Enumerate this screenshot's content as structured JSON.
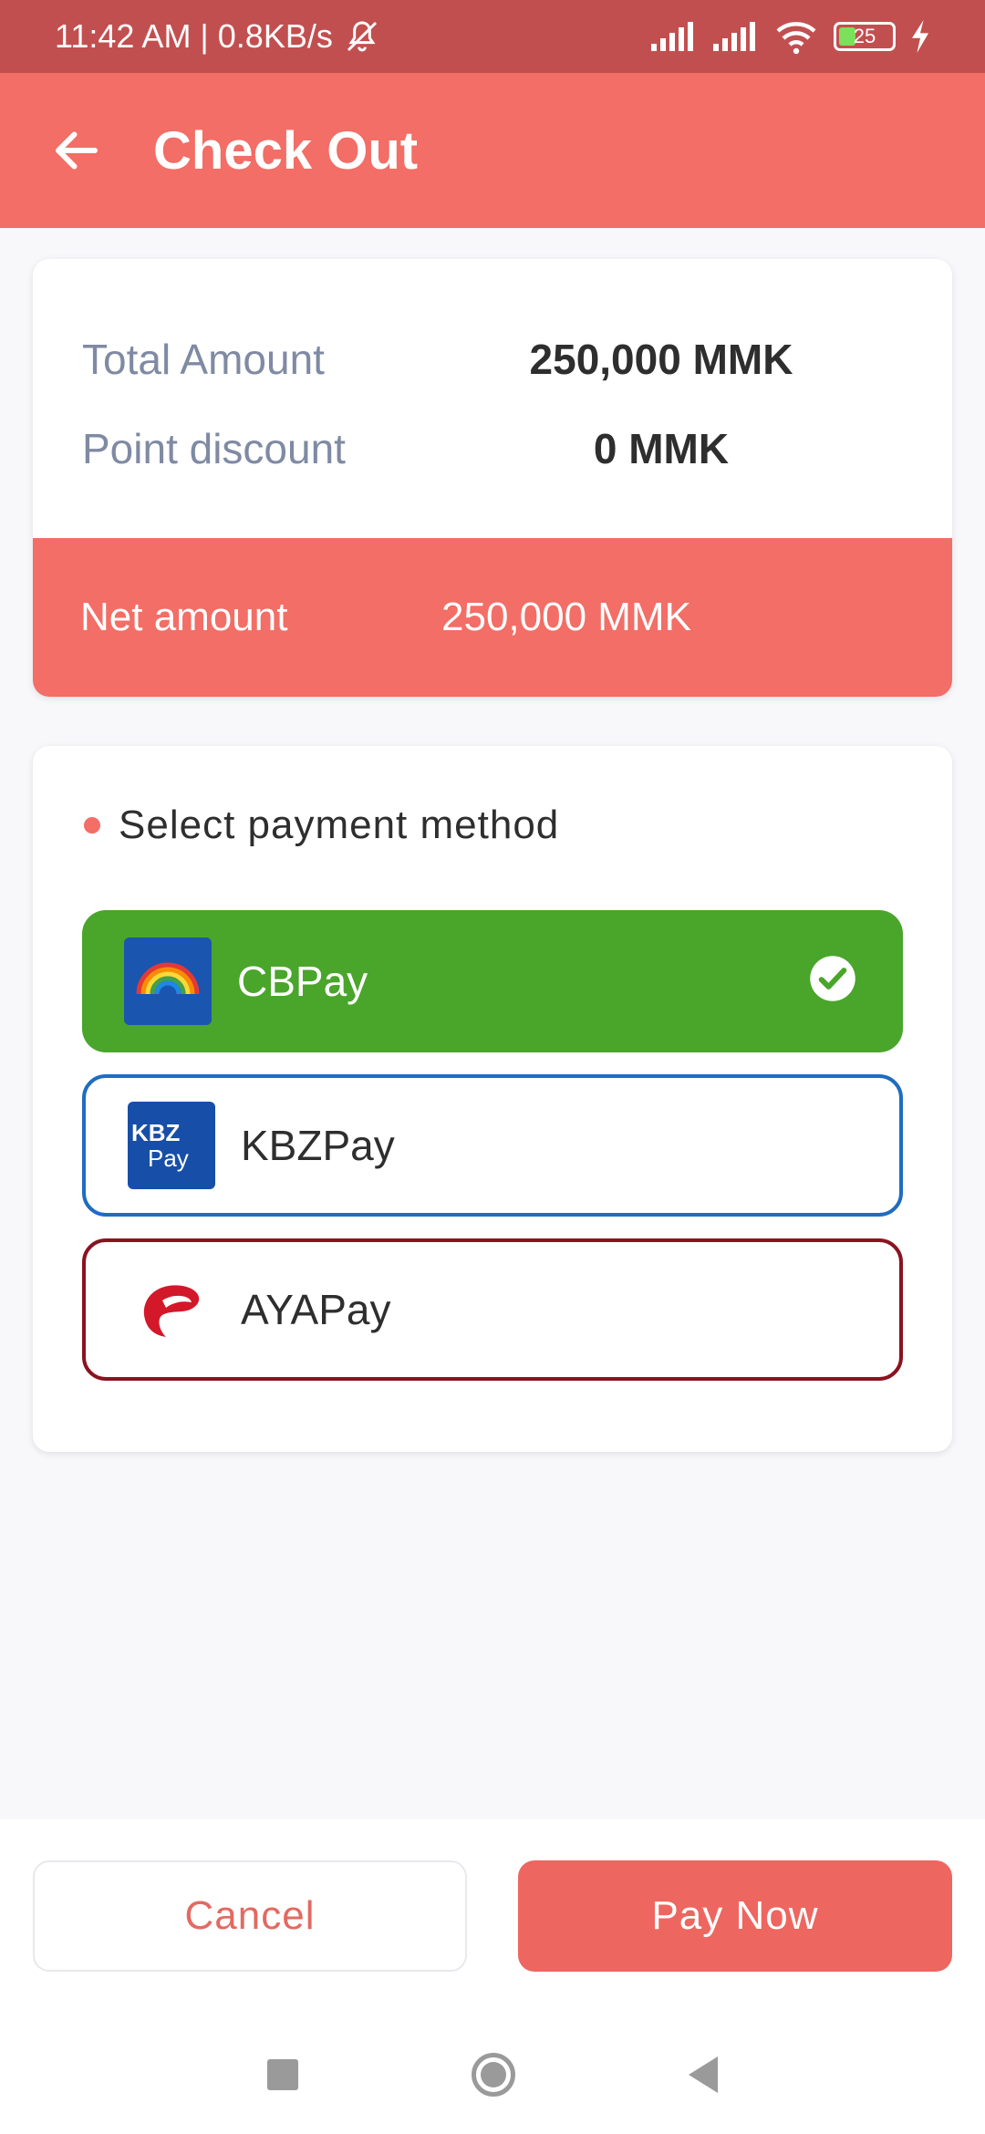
{
  "status_bar": {
    "time_speed": "11:42 AM | 0.8KB/s",
    "battery": "25",
    "icons": [
      "bell-off-icon",
      "signal-icon",
      "signal-icon",
      "wifi-icon",
      "battery-icon",
      "charging-icon"
    ]
  },
  "app_bar": {
    "title": "Check Out",
    "back_icon": "arrow-left-icon"
  },
  "summary": {
    "total_label": "Total Amount",
    "total_value": "250,000 MMK",
    "discount_label": "Point discount",
    "discount_value": "0 MMK",
    "net_label": "Net amount",
    "net_value": "250,000 MMK"
  },
  "payment": {
    "heading": "Select payment method",
    "options": [
      {
        "label": "CBPay",
        "selected": true,
        "logo": "rainbow-logo"
      },
      {
        "label": "KBZPay",
        "selected": false,
        "logo": "kbz-logo",
        "logo_line1": "KBZ",
        "logo_line2": "Pay"
      },
      {
        "label": "AYAPay",
        "selected": false,
        "logo": "aya-logo"
      }
    ]
  },
  "buttons": {
    "cancel": "Cancel",
    "pay_now": "Pay Now"
  },
  "colors": {
    "accent": "#F26E66",
    "status_bar": "#C24F4F",
    "selected_green": "#4AA52B",
    "kbz_blue": "#1F6CC1",
    "aya_maroon": "#8A1320"
  }
}
